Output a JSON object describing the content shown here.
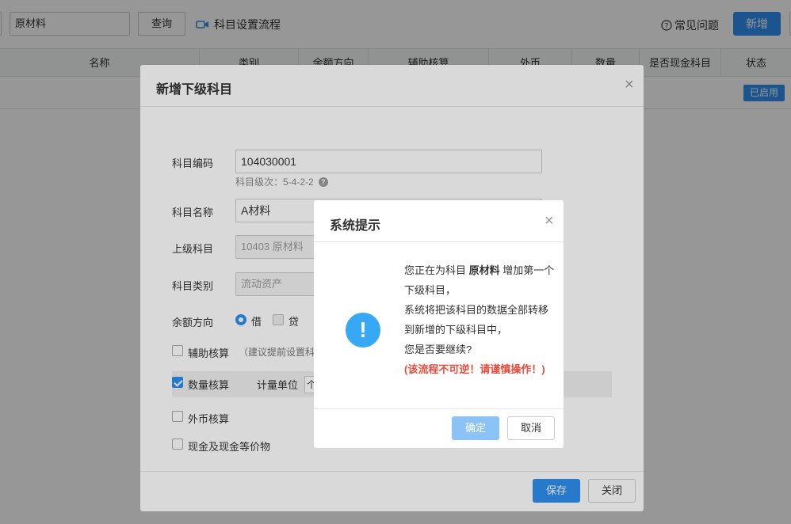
{
  "toolbar": {
    "search_value": "原材料",
    "query_label": "查询",
    "flow_label": "科目设置流程",
    "faq_label": "常见问题",
    "add_label": "新增"
  },
  "table": {
    "headers": [
      "名称",
      "类别",
      "余额方向",
      "辅助核算",
      "外币",
      "数量",
      "是否现金科目",
      "状态"
    ],
    "row_status": "已启用"
  },
  "dialog": {
    "title": "新增下级科目",
    "code_label": "科目编码",
    "code_value": "104030001",
    "level_hint": "科目级次：5-4-2-2",
    "name_label": "科目名称",
    "name_value": "A材料",
    "parent_label": "上级科目",
    "parent_value": "10403 原材料",
    "category_label": "科目类别",
    "category_value": "流动资产",
    "direction_label": "余额方向",
    "debit_label": "借",
    "credit_label": "贷",
    "aux_label": "辅助核算",
    "aux_note": "（建议提前设置科目",
    "qty_label": "数量核算",
    "unit_label": "计量单位",
    "unit_value": "个",
    "fx_label": "外币核算",
    "cash_label": "现金及现金等价物",
    "save_label": "保存",
    "close_label": "关闭"
  },
  "confirm": {
    "title": "系统提示",
    "msg_prefix": "您正在为科目 ",
    "msg_subject": "原材料",
    "msg_suffix": " 增加第一个下级科目，",
    "msg_line2": "系统将把该科目的数据全部转移到新增的下级科目中，",
    "msg_line3": "您是否要继续?",
    "msg_warn": "(该流程不可逆！请谨慎操作！)",
    "ok_label": "确定",
    "cancel_label": "取消"
  }
}
